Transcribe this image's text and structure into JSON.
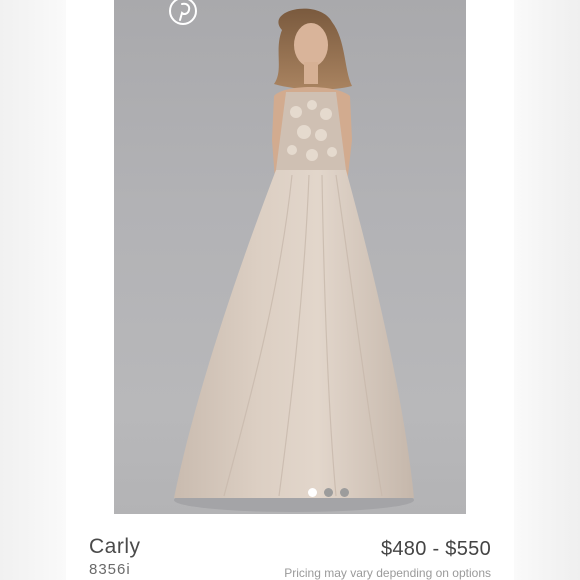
{
  "product": {
    "name": "Carly",
    "sku": "8356i",
    "price": "$480 - $550",
    "price_note": "Pricing may vary depending on options"
  },
  "gallery": {
    "slide_count": 3,
    "active_index": 0
  },
  "icons": {
    "share": "pinterest-icon"
  },
  "colors": {
    "photo_background": "#b0b0b3",
    "dress": "#d7c9bc",
    "text": "#4a4a4a",
    "note": "#9a9a9a"
  }
}
